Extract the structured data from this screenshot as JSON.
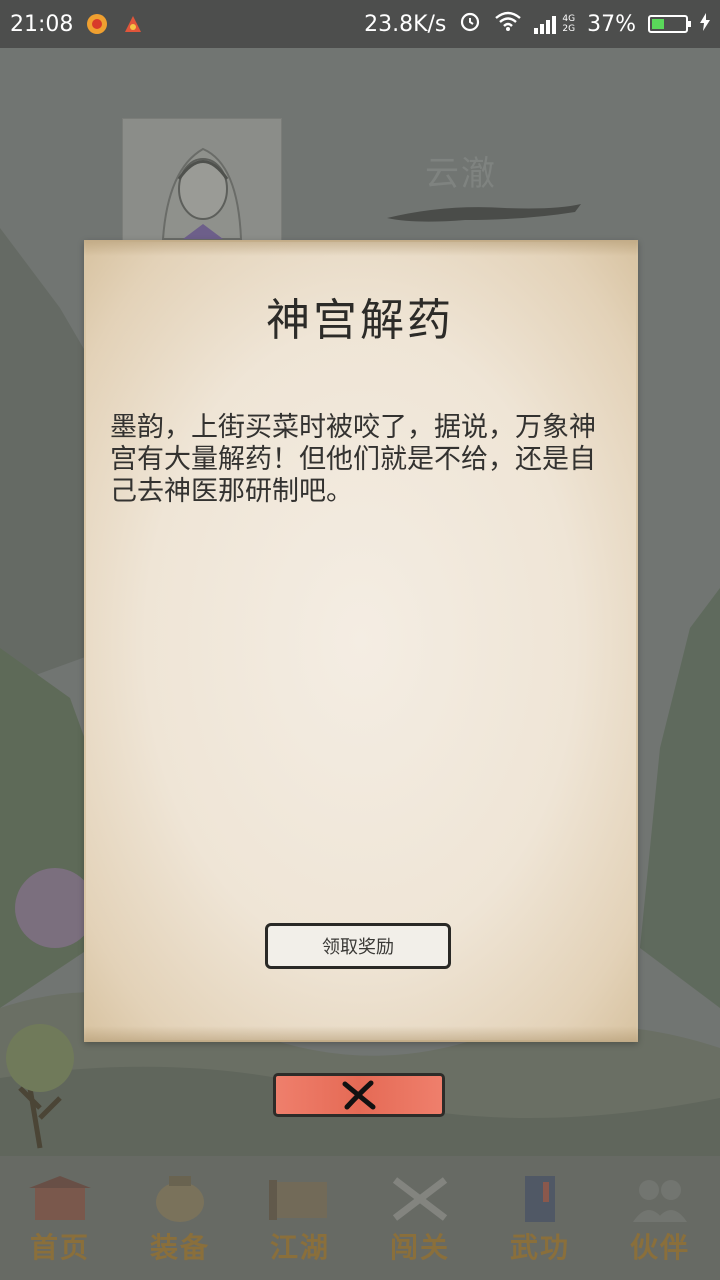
{
  "status_bar": {
    "time": "21:08",
    "net_speed": "23.8K/s",
    "network_labels": [
      "4G",
      "2G"
    ],
    "battery_percent": "37%",
    "battery_level": 0.37
  },
  "background": {
    "hero_name": "云澈"
  },
  "dialog": {
    "title": "神宫解药",
    "body": "墨韵，上街买菜时被咬了，据说，万象神宫有大量解药！但他们就是不给，还是自己去神医那研制吧。",
    "claim_button_label": "领取奖励"
  },
  "bottom_nav": {
    "items": [
      {
        "label": "首页",
        "icon": "gate-icon"
      },
      {
        "label": "装备",
        "icon": "jar-icon"
      },
      {
        "label": "江湖",
        "icon": "scroll-icon"
      },
      {
        "label": "闯关",
        "icon": "swords-icon"
      },
      {
        "label": "武功",
        "icon": "book-icon"
      },
      {
        "label": "伙伴",
        "icon": "people-icon"
      }
    ]
  },
  "colors": {
    "overlay": "#6f726f",
    "paper": "#efe5d6",
    "close_button": "#e56a55",
    "nav_label": "#8a6f3b"
  }
}
